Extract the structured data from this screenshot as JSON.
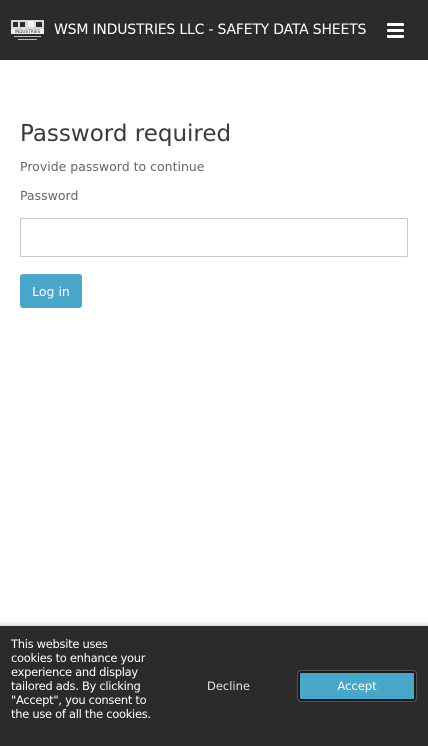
{
  "header": {
    "logo_icon": "company-logo-icon",
    "logo_text": "INDUSTRIES",
    "title": "WSM INDUSTRIES LLC - SAFETY DATA SHEETS",
    "menu_icon": "hamburger-menu-icon"
  },
  "main": {
    "title": "Password required",
    "subtitle": "Provide password to continue",
    "password_label": "Password",
    "password_value": "",
    "login_label": "Log in"
  },
  "cookie_banner": {
    "message": "This website uses cookies to enhance your experience and display tailored ads. By clicking \"Accept\", you consent to the use of all the cookies.",
    "decline_label": "Decline",
    "accept_label": "Accept"
  },
  "colors": {
    "header_bg": "#2b2b2b",
    "accent": "#4aa7c9",
    "text": "#3a3a3a"
  }
}
